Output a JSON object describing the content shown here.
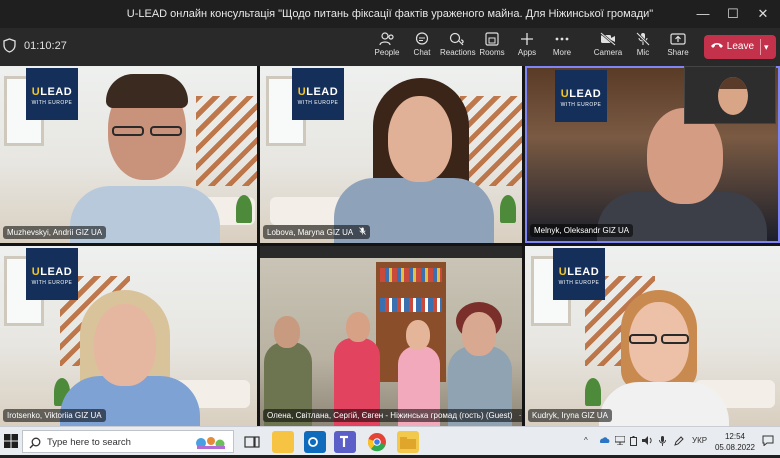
{
  "window": {
    "title": "U-LEAD онлайн консультація \"Щодо питань фіксації фактів ураженого майна. Для Ніжинської громади\"",
    "controls": [
      "—",
      "☐",
      "✕"
    ]
  },
  "toolbar": {
    "timer": "01:10:27",
    "buttons": [
      {
        "label": "People",
        "icon": "people-icon"
      },
      {
        "label": "Chat",
        "icon": "chat-icon"
      },
      {
        "label": "Reactions",
        "icon": "reactions-icon"
      },
      {
        "label": "Rooms",
        "icon": "rooms-icon"
      },
      {
        "label": "Apps",
        "icon": "apps-icon"
      },
      {
        "label": "More",
        "icon": "more-icon"
      },
      {
        "label": "Camera",
        "icon": "camera-off-icon"
      },
      {
        "label": "Mic",
        "icon": "mic-off-icon"
      },
      {
        "label": "Share",
        "icon": "share-icon"
      }
    ],
    "leave_label": "Leave"
  },
  "logo": {
    "text": "LEAD",
    "letter": "U",
    "sub": "WITH EUROPE"
  },
  "participants": [
    {
      "name": "Muzhevskyi, Andrii GIZ UA",
      "muted": false
    },
    {
      "name": "Lobova, Maryna GIZ UA",
      "muted": true
    },
    {
      "name": "Melnyk, Oleksandr GIZ UA",
      "muted": false
    },
    {
      "name": "Irotsenko, Viktoriia GIZ UA",
      "muted": false
    },
    {
      "name": "Олена, Світлана, Сергій, Євген - Ніжинська громад (гость) (Guest)",
      "muted": false,
      "more": "···"
    },
    {
      "name": "Kudryk, Iryna GIZ UA",
      "muted": false
    }
  ],
  "taskbar": {
    "search_placeholder": "Type here to search",
    "language": "УКР",
    "time": "12:54",
    "date": "05.08.2022"
  },
  "colors": {
    "leave": "#c4314b",
    "active_speaker": "#7f85f5",
    "logo_bg": "#14305a",
    "logo_accent": "#f3c623"
  }
}
